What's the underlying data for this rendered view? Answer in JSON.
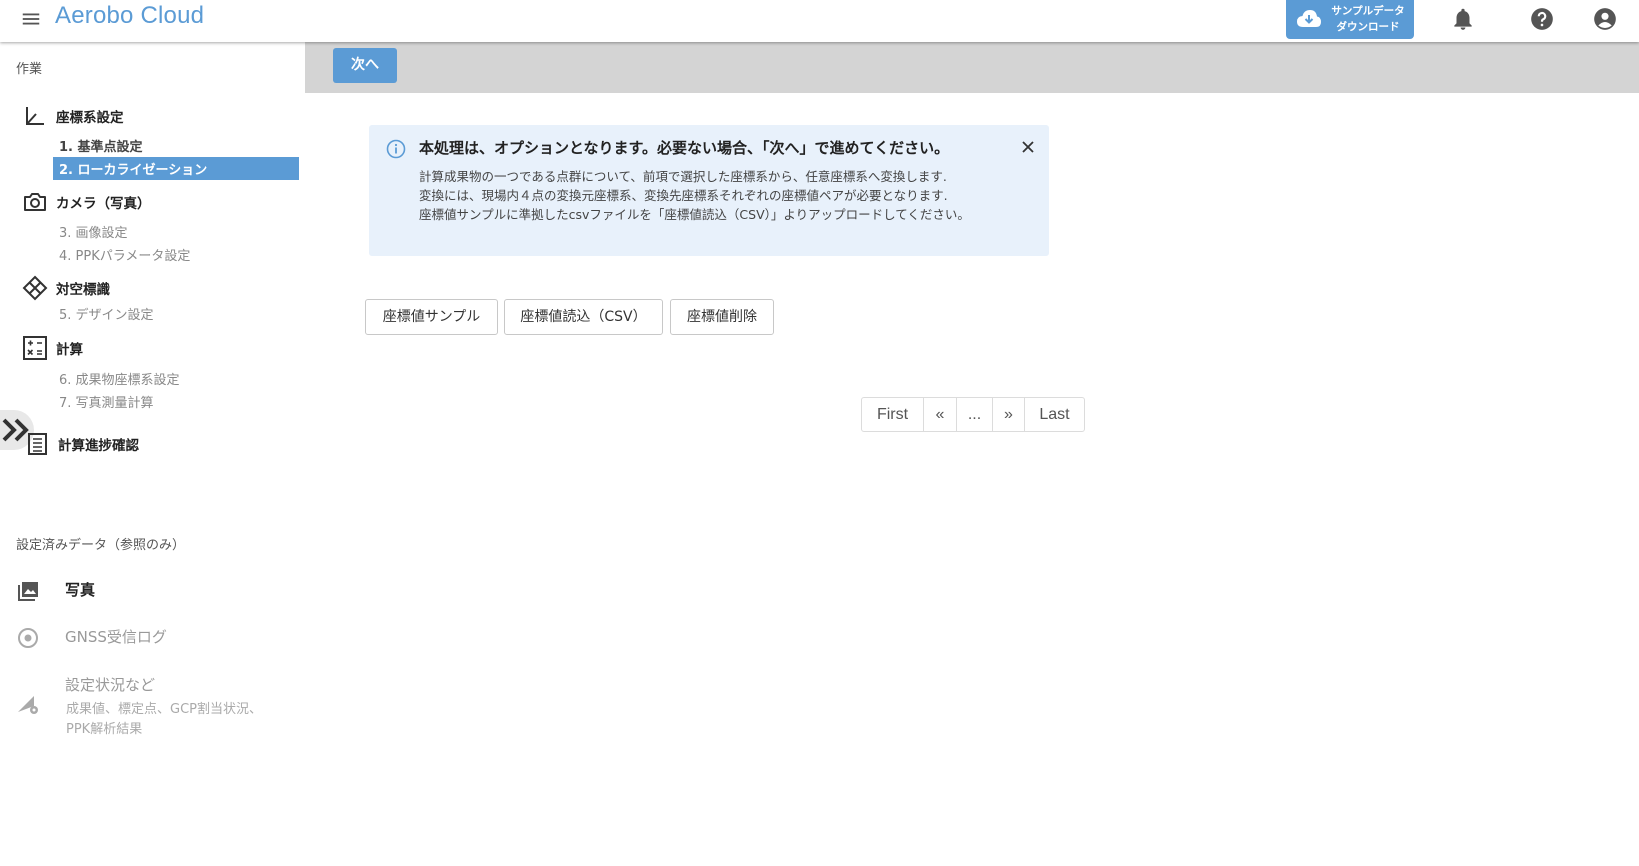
{
  "header": {
    "title": "Aerobo Cloud",
    "download_line1": "サンプルデータ",
    "download_line2": "ダウンロード",
    "icons": [
      "menu-icon",
      "cloud-download-icon",
      "bell-icon",
      "help-icon",
      "account-icon"
    ]
  },
  "sidebar": {
    "work_label": "作業",
    "groups": [
      {
        "label": "座標系設定",
        "icon": "axis-icon",
        "items": [
          {
            "label": "1. 基準点設定",
            "state": "done"
          },
          {
            "label": "2. ローカライゼーション",
            "state": "active"
          }
        ]
      },
      {
        "label": "カメラ（写真）",
        "icon": "camera-icon",
        "items": [
          {
            "label": "3. 画像設定",
            "state": "todo"
          },
          {
            "label": "4. PPKパラメータ設定",
            "state": "todo"
          }
        ]
      },
      {
        "label": "対空標識",
        "icon": "target-icon",
        "items": [
          {
            "label": "5. デザイン設定",
            "state": "todo"
          }
        ]
      },
      {
        "label": "計算",
        "icon": "calculator-icon",
        "items": [
          {
            "label": "6. 成果物座標系設定",
            "state": "todo"
          },
          {
            "label": "7. 写真測量計算",
            "state": "todo"
          }
        ]
      },
      {
        "label": "計算進捗確認",
        "icon": "list-icon",
        "items": []
      }
    ],
    "ref_label": "設定済みデータ（参照のみ）",
    "ref_items": [
      {
        "label": "写真",
        "icon": "photo-icon"
      },
      {
        "label": "GNSS受信ログ",
        "icon": "gnss-icon"
      },
      {
        "label": "設定状況など",
        "icon": "signal-settings-icon",
        "sub": "成果値、標定点、GCP割当状況、PPK解析結果"
      }
    ]
  },
  "toolbar": {
    "next_label": "次へ"
  },
  "alert": {
    "title": "本処理は、オプションとなります。必要ない場合、「次へ」で進めてください。",
    "body": [
      "計算成果物の一つである点群について、前項で選択した座標系から、任意座標系へ変換します.",
      "変換には、現場内４点の変換元座標系、変換先座標系それぞれの座標値ペアが必要となります.",
      "座標値サンプルに準拠したcsvファイルを「座標値読込（CSV）」よりアップロードしてください。"
    ]
  },
  "actions": {
    "sample": "座標値サンプル",
    "import_csv": "座標値読込（CSV）",
    "delete": "座標値削除"
  },
  "pagination": {
    "first": "First",
    "prev": "«",
    "ellipsis": "...",
    "next": "»",
    "last": "Last"
  },
  "colors": {
    "accent": "#5b9bd5",
    "toolbar": "#d4d4d4",
    "alert_bg": "#e8f1fb"
  }
}
